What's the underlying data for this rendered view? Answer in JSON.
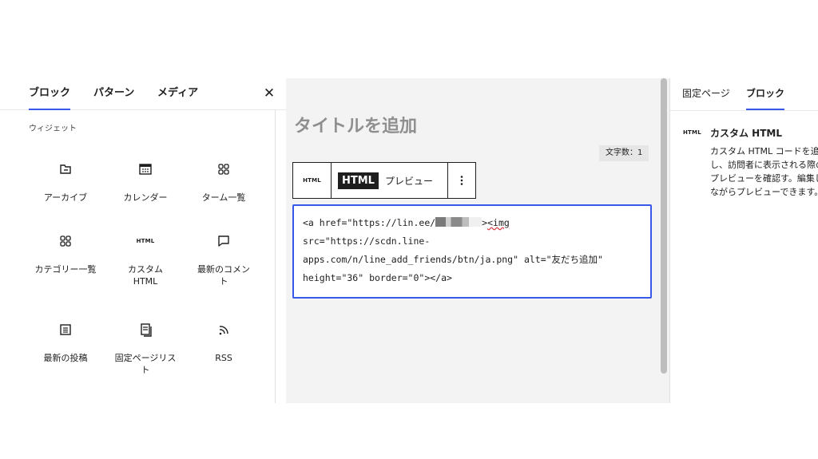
{
  "inserter": {
    "tabs": [
      "ブロック",
      "パターン",
      "メディア"
    ],
    "close_icon": "close-icon",
    "section_title": "ウィジェット",
    "blocks": [
      {
        "label": "アーカイブ",
        "icon": "archive-icon"
      },
      {
        "label": "カレンダー",
        "icon": "calendar-icon"
      },
      {
        "label": "ターム一覧",
        "icon": "grid-icon"
      },
      {
        "label": "カテゴリー一覧",
        "icon": "grid-icon"
      },
      {
        "label": "カスタム HTML",
        "icon": "html-icon",
        "glyph": "HTML"
      },
      {
        "label": "最新のコメント",
        "icon": "comment-icon"
      },
      {
        "label": "最新の投稿",
        "icon": "list-icon"
      },
      {
        "label": "固定ページリスト",
        "icon": "pages-icon"
      },
      {
        "label": "RSS",
        "icon": "rss-icon"
      }
    ]
  },
  "editor": {
    "title_placeholder": "タイトルを追加",
    "char_count": "文字数：1",
    "toolbar": {
      "block_icon_text": "HTML",
      "html_label": "HTML",
      "preview_label": "プレビュー",
      "more_icon": "more-vertical-icon"
    },
    "code": {
      "line1_start": "<a href=\"https://lin.ee/",
      "line1_end": ">",
      "line1_tag": "<img",
      "line2": "src=\"https://scdn.line-",
      "line3": "apps.com/n/line_add_friends/btn/ja.png\" alt=\"友だち追加\"",
      "line4": "height=\"36\" border=\"0\"></a>"
    }
  },
  "sidebar": {
    "tabs": [
      "固定ページ",
      "ブロック"
    ],
    "block_icon_text": "HTML",
    "block_title": "カスタム HTML",
    "block_description": "カスタム HTML コードを追加し、訪問者に表示される際のプレビューを確認す。編集しながらプレビューできます。"
  },
  "colors": {
    "accent": "#3858e9",
    "canvas_bg": "#f3f3f3"
  }
}
